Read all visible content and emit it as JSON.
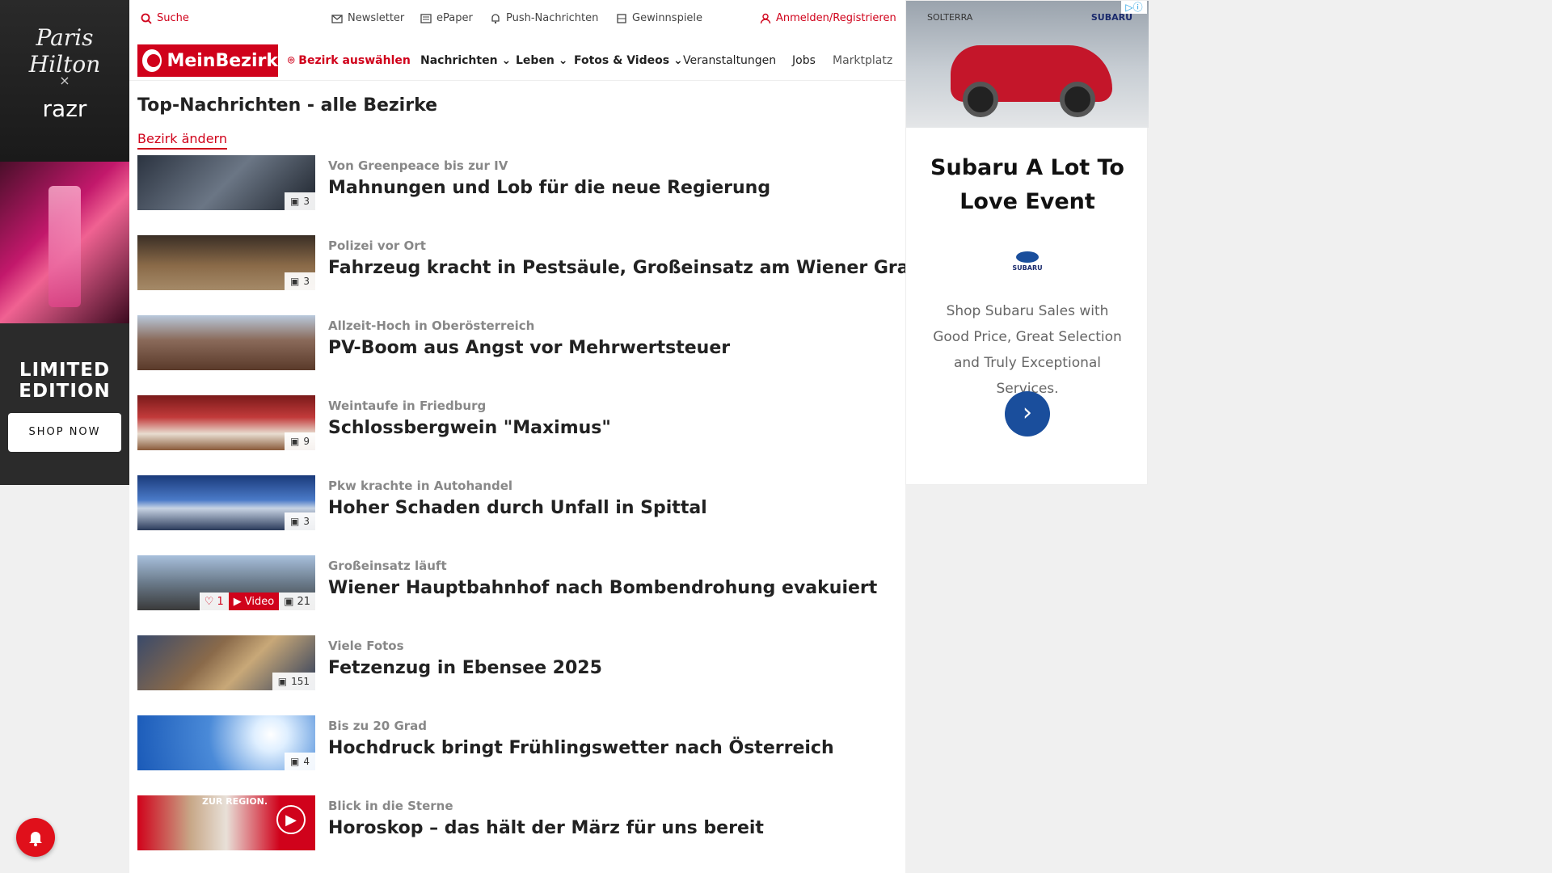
{
  "left_ad": {
    "signature": "Paris Hilton",
    "times": "×",
    "partner": "razr",
    "edition": "LIMITED EDITION",
    "cta": "SHOP NOW"
  },
  "topbar": {
    "search": "Suche",
    "newsletter": "Newsletter",
    "epaper": "ePaper",
    "push": "Push-Nachrichten",
    "games": "Gewinnspiele",
    "login": "Anmelden/Registrieren"
  },
  "nav": {
    "logo": "MeinBezirk",
    "district": "Bezirk auswählen",
    "news": "Nachrichten",
    "life": "Leben",
    "media": "Fotos & Videos",
    "events": "Veranstaltungen",
    "jobs": "Jobs",
    "market": "Marktplatz"
  },
  "section": {
    "title": "Top-Nachrichten - alle Bezirke",
    "change": "Bezirk ändern"
  },
  "articles": [
    {
      "kicker": "Von Greenpeace bis zur IV",
      "headline": "Mahnungen und Lob für die neue Regierung",
      "count": "3"
    },
    {
      "kicker": "Polizei vor Ort",
      "headline": "Fahrzeug kracht in Pestsäule, Großeinsatz am Wiener Graben",
      "count": "3"
    },
    {
      "kicker": "Allzeit-Hoch in Oberösterreich",
      "headline": "PV-Boom aus Angst vor Mehrwertsteuer",
      "count": ""
    },
    {
      "kicker": "Weintaufe in Friedburg",
      "headline": "Schlossbergwein \"Maximus\"",
      "count": "9"
    },
    {
      "kicker": "Pkw krachte in Autohandel",
      "headline": "Hoher Schaden durch Unfall in Spittal",
      "count": "3"
    },
    {
      "kicker": "Großeinsatz läuft",
      "headline": "Wiener Hauptbahnhof nach Bombendrohung evakuiert",
      "count": "21",
      "likes": "1",
      "video": "Video"
    },
    {
      "kicker": "Viele Fotos",
      "headline": "Fetzenzug in Ebensee 2025",
      "count": "151"
    },
    {
      "kicker": "Bis zu 20 Grad",
      "headline": "Hochdruck bringt Frühlingswetter nach Österreich",
      "count": "4"
    },
    {
      "kicker": "Blick in die Sterne",
      "headline": "Horoskop – das hält der März für uns bereit",
      "count": "",
      "overlay": "ZUR REGION."
    }
  ],
  "right_ad": {
    "model": "SOLTERRA",
    "brand": "SUBARU",
    "title": "Subaru A Lot To Love Event",
    "dealer": "SUBARU",
    "desc": "Shop Subaru Sales with Good Price, Great Selection and Truly Exceptional Services.",
    "go": "›"
  },
  "colors": {
    "accent": "#d0021b",
    "subaru_blue": "#1a4e9c"
  }
}
